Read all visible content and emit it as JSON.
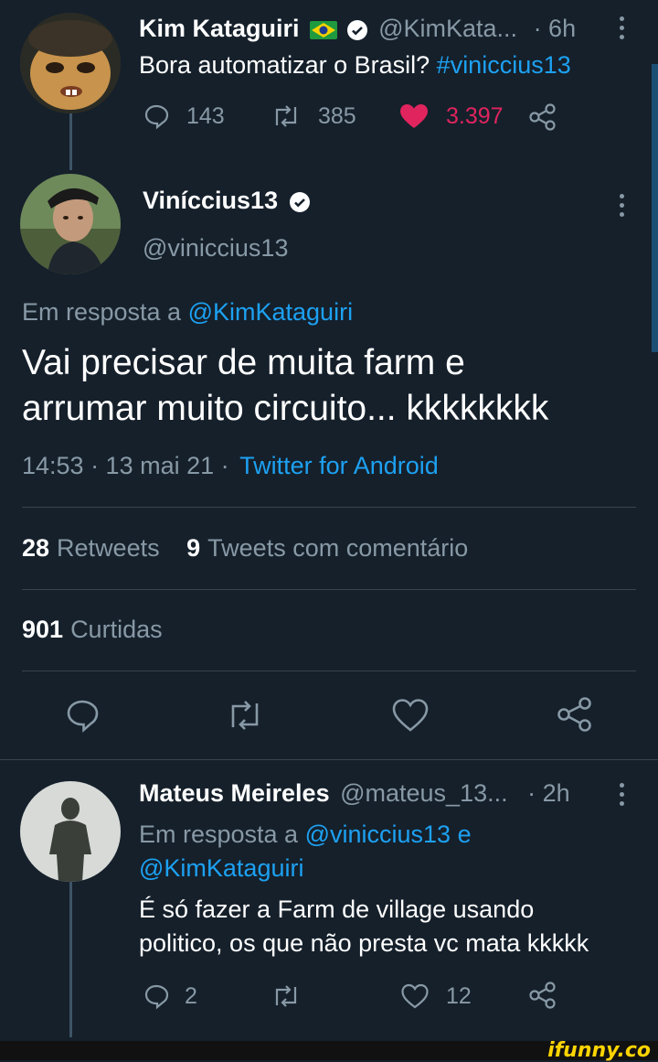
{
  "tweet1": {
    "name": "Kim Kataguiri",
    "flag": "🇧🇷",
    "handle": "@KimKata...",
    "time": "· 6h",
    "text": "Bora automatizar o Brasil?",
    "hashtag": "#viniccius13",
    "replies": "143",
    "retweets": "385",
    "likes": "3.397"
  },
  "main": {
    "name": "Viníccius13",
    "handle": "@viniccius13",
    "reply_prefix": "Em resposta a",
    "reply_to": "@KimKataguiri",
    "text_line1": "Vai precisar de muita farm e",
    "text_line2": "arrumar muito circuito... kkkkkkkk",
    "timestamp": "14:53 · 13 mai 21 ·",
    "source": "Twitter for Android",
    "retweets_count": "28",
    "retweets_label": "Retweets",
    "quotes_count": "9",
    "quotes_label": "Tweets com comentário",
    "likes_count": "901",
    "likes_label": "Curtidas"
  },
  "reply": {
    "name": "Mateus Meireles",
    "handle": "@mateus_13...",
    "time": "· 2h",
    "reply_prefix": "Em resposta a",
    "reply_to1": "@viniccius13",
    "reply_and": "e",
    "reply_to2": "@KimKataguiri",
    "text_line1": "É só fazer a Farm de village usando",
    "text_line2": "politico, os que não presta vc mata kkkkk",
    "replies": "2",
    "likes": "12"
  },
  "watermark": "ifunny.co",
  "colors": {
    "background": "#15202b",
    "accent": "#1da1f2",
    "like_red": "#e0245e",
    "muted": "#8899a6"
  },
  "icons": [
    "reply-icon",
    "retweet-icon",
    "heart-icon",
    "share-icon",
    "verified-icon",
    "more-icon"
  ]
}
